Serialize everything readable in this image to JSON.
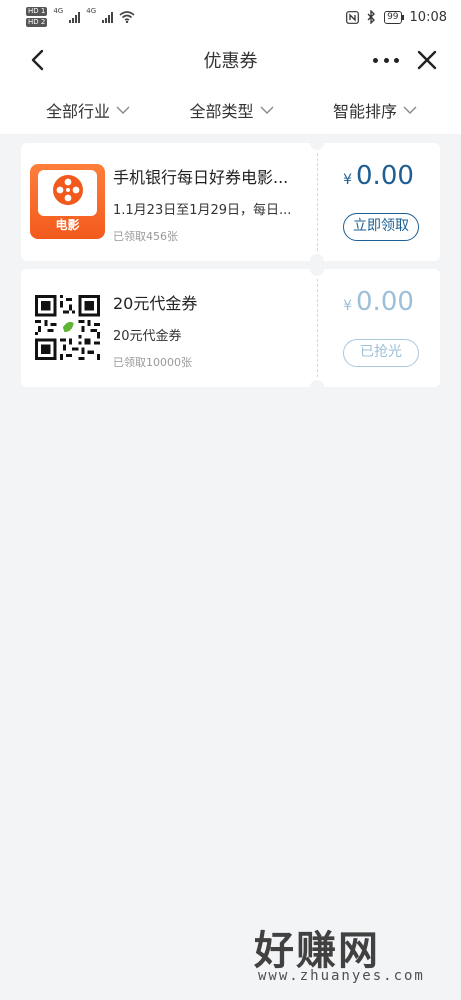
{
  "status_bar": {
    "hd1": "HD 1",
    "hd2": "HD 2",
    "net1": "4G",
    "net2": "4G",
    "battery": "99",
    "time": "10:08",
    "icons": [
      "nfc-icon",
      "bluetooth-icon",
      "wifi-icon",
      "signal-icon"
    ]
  },
  "nav": {
    "title": "优惠券"
  },
  "filters": [
    {
      "label": "全部行业"
    },
    {
      "label": "全部类型"
    },
    {
      "label": "智能排序"
    }
  ],
  "coupons": [
    {
      "title": "手机银行每日好券电影...",
      "subtitle": "1.1月23日至1月29日，每日...",
      "count": "已领取456张",
      "currency": "¥",
      "amount": "0.00",
      "action": "立即领取",
      "thumb_label": "电影",
      "state": "available"
    },
    {
      "title": "20元代金券",
      "subtitle": "20元代金券",
      "count": "已领取10000张",
      "currency": "¥",
      "amount": "0.00",
      "action": "已抢光",
      "state": "sold-out"
    }
  ],
  "watermark": {
    "logo_text": "好赚网",
    "url_text": "www.zhuanyes.com"
  },
  "colors": {
    "accent": "#1d5f95",
    "muted_accent": "#9cc0d8",
    "background": "#f3f4f6",
    "movie_orange": "#f25a1d"
  }
}
